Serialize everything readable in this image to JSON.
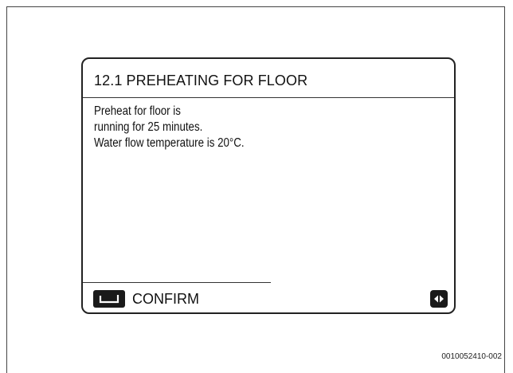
{
  "screen": {
    "title": "12.1 PREHEATING FOR FLOOR",
    "message_lines": [
      "Preheat for floor is",
      "running for 25 minutes.",
      "Water flow temperature is 20°C."
    ]
  },
  "footer": {
    "confirm_label": "CONFIRM",
    "enter_icon": "enter-return-icon",
    "nav_icon": "left-right-arrows-icon"
  },
  "figure": {
    "id": "0010052410-002"
  }
}
